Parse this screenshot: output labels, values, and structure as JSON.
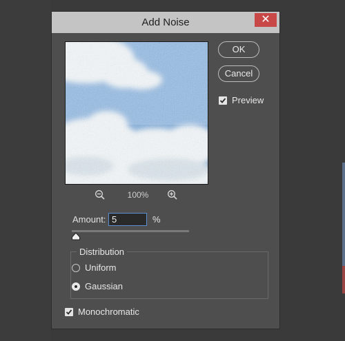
{
  "dialog": {
    "title": "Add Noise",
    "close_glyph": "✕"
  },
  "preview": {
    "zoom_level": "100%",
    "zoom_out_icon": "zoom-out-icon",
    "zoom_in_icon": "zoom-in-icon",
    "image": "cloudy sky with noise"
  },
  "buttons": {
    "ok_label": "OK",
    "cancel_label": "Cancel"
  },
  "preview_toggle": {
    "label": "Preview",
    "checked": true
  },
  "amount": {
    "label": "Amount:",
    "value": "5",
    "unit": "%",
    "slider_fraction": 0.01
  },
  "distribution": {
    "legend": "Distribution",
    "options": [
      {
        "label": "Uniform",
        "selected": false
      },
      {
        "label": "Gaussian",
        "selected": true
      }
    ]
  },
  "monochromatic": {
    "label": "Monochromatic",
    "checked": true
  },
  "colors": {
    "dialog_bg": "#4e4e4e",
    "titlebar_bg": "#c4c4c4",
    "close_bg": "#c84848",
    "input_focus_border": "#5b8fd6",
    "sky": "#8ab0d8"
  }
}
